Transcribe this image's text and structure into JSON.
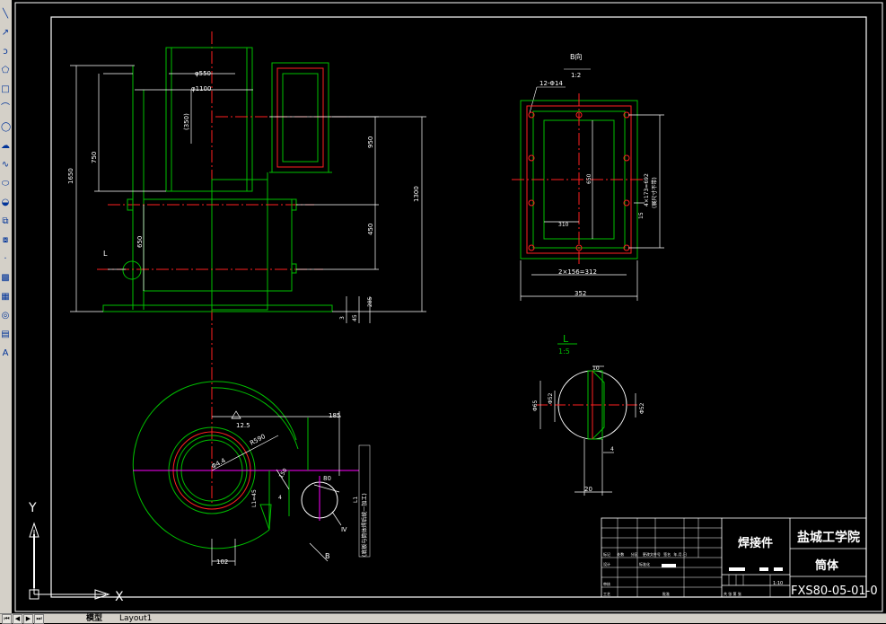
{
  "toolbar": {
    "tools": [
      {
        "icon": "line-icon",
        "glyph": "╲"
      },
      {
        "icon": "construction-line-icon",
        "glyph": "↗"
      },
      {
        "icon": "polyline-icon",
        "glyph": "ↄ"
      },
      {
        "icon": "polygon-icon",
        "glyph": "⬠"
      },
      {
        "icon": "rectangle-icon",
        "glyph": "□"
      },
      {
        "icon": "arc-icon",
        "glyph": "⌒"
      },
      {
        "icon": "circle-icon",
        "glyph": "◯"
      },
      {
        "icon": "revision-cloud-icon",
        "glyph": "☁"
      },
      {
        "icon": "spline-icon",
        "glyph": "∿"
      },
      {
        "icon": "ellipse-icon",
        "glyph": "⬭"
      },
      {
        "icon": "ellipse-arc-icon",
        "glyph": "◒"
      },
      {
        "icon": "insert-block-icon",
        "glyph": "⧉"
      },
      {
        "icon": "make-block-icon",
        "glyph": "⧇"
      },
      {
        "icon": "point-icon",
        "glyph": "·"
      },
      {
        "icon": "hatch-icon",
        "glyph": "▩"
      },
      {
        "icon": "gradient-icon",
        "glyph": "▦"
      },
      {
        "icon": "region-icon",
        "glyph": "◎"
      },
      {
        "icon": "table-icon",
        "glyph": "▤"
      },
      {
        "icon": "multiline-text-icon",
        "glyph": "A"
      }
    ]
  },
  "tabs": {
    "model": "模型",
    "layout1": "Layout1"
  },
  "drawing": {
    "front_dims": {
      "d550": "φ550",
      "d1100": "φ1100",
      "h350": "(350)",
      "h1650": "1650",
      "h750": "750",
      "h950": "950",
      "h1300": "1300",
      "h450": "450",
      "h650": "650",
      "h285": "285",
      "h3": "3",
      "h45": "45",
      "label_l": "L"
    },
    "bview": {
      "title": "B向",
      "scale": "1:2",
      "holes": "12-Φ14",
      "d650": "650",
      "d310": "310",
      "d_bottom": "2×156=312",
      "d352": "352",
      "d15": "15",
      "d_side": "4×173=692",
      "d_side_note": "(展尺寸不带)"
    },
    "detail": {
      "title": "L",
      "scale": "1:5",
      "d10": "10",
      "d65": "Φ65",
      "d52": "Φ52",
      "d4": "4",
      "d20": "20"
    },
    "plan_dims": {
      "d185": "185",
      "r590": "R590",
      "roughness": "12.5",
      "d104": "Φ4.4",
      "d150": "150",
      "d80": "80",
      "l45": "L1=45",
      "d4": "4",
      "l1": "L1",
      "d102": "102",
      "arrow_b": "B",
      "pipe": "Ⅳ",
      "note": "(底板与筒体焊后统一加工)"
    },
    "titleblock": {
      "school": "盐城工学院",
      "part_type": "焊接件",
      "part_name": "筒体",
      "drawing_no": "FXS80-05-01-0",
      "scale": "1:10",
      "sheet": "共  张  第  张",
      "rows_left": [
        "标记",
        "处数",
        "分区",
        "更改文件号",
        "签名",
        "年.月.日"
      ],
      "row_design": "设计",
      "row_std": "标准化",
      "row_check": "审核",
      "row_process": "工艺",
      "row_approve": "批准"
    },
    "ucs": {
      "x": "X",
      "y": "Y"
    }
  },
  "colors": {
    "line_green": "#00c000",
    "line_red": "#ff2020",
    "line_white": "#ffffff",
    "line_magenta": "#ff00ff",
    "toolbar_bg": "#d4d0c8"
  }
}
